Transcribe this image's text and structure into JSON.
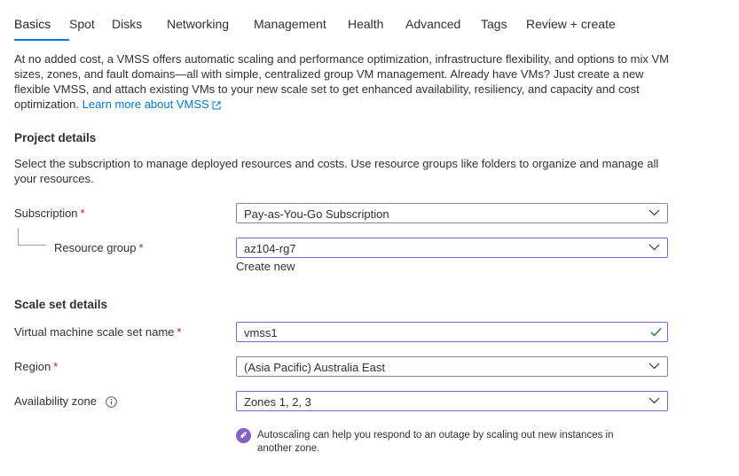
{
  "tabs": [
    {
      "label": "Basics",
      "active": true
    },
    {
      "label": "Spot"
    },
    {
      "label": "Disks"
    },
    {
      "label": "Networking"
    },
    {
      "label": "Management"
    },
    {
      "label": "Health"
    },
    {
      "label": "Advanced"
    },
    {
      "label": "Tags"
    },
    {
      "label": "Review + create"
    }
  ],
  "intro": {
    "text": "At no added cost, a VMSS offers automatic scaling and performance optimization, infrastructure flexibility, and options to mix VM sizes, zones, and fault domains—all with simple, centralized group VM management. Already have VMs? Just create a new flexible VMSS, and attach existing VMs to your new scale set to get enhanced availability, resiliency, and capacity and cost optimization.",
    "link": "Learn more about VMSS"
  },
  "project": {
    "title": "Project details",
    "description": "Select the subscription to manage deployed resources and costs. Use resource groups like folders to organize and manage all your resources.",
    "subscription_label": "Subscription",
    "subscription_value": "Pay-as-You-Go Subscription",
    "rg_label": "Resource group",
    "rg_value": "az104-rg7",
    "create_new": "Create new"
  },
  "scaleset": {
    "title": "Scale set details",
    "name_label": "Virtual machine scale set name",
    "name_value": "vmss1",
    "region_label": "Region",
    "region_value": "(Asia Pacific) Australia East",
    "zone_label": "Availability zone",
    "zone_value": "Zones 1, 2, 3",
    "note": "Autoscaling can help you respond to an outage by scaling out new instances in another zone."
  },
  "required_mark": "*",
  "colors": {
    "accent": "#0078d4",
    "focus": "#8661c5",
    "required": "#a4262c",
    "success": "#107c10"
  }
}
